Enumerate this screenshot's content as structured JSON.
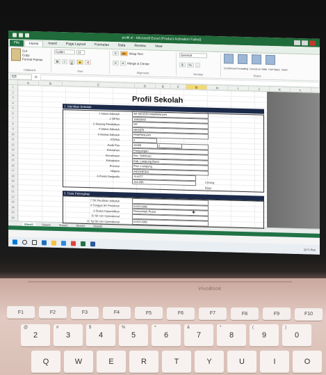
{
  "excel": {
    "window_title": "profil.xl - Microsoft Excel (Product Activation Failed)",
    "tabs": [
      "File",
      "Home",
      "Insert",
      "Page Layout",
      "Formulas",
      "Data",
      "Review",
      "View"
    ],
    "ribbon": {
      "clipboard": {
        "cut": "Cut",
        "copy": "Copy",
        "format_painter": "Format Painter",
        "paste": "Paste",
        "label": "Clipboard"
      },
      "font": {
        "name": "Calibri",
        "size": "11",
        "label": "Font"
      },
      "alignment": {
        "wrap_text": "Wrap Text",
        "merge_center": "Merge & Center",
        "label": "Alignment"
      },
      "number": {
        "format": "General",
        "label": "Number"
      },
      "styles": {
        "conditional": "Conditional Formatting",
        "format_as_table": "Format as Table",
        "cell_styles": "Cell Styles",
        "label": "Styles"
      },
      "insert": "Insert"
    },
    "namebox": "G3",
    "fx": "fx",
    "columns": [
      "A",
      "B",
      "C",
      "D",
      "E",
      "F",
      "G",
      "H",
      "I",
      "J",
      "K",
      "L"
    ],
    "selected_column": "G",
    "rows": [
      "1",
      "2",
      "3",
      "4",
      "5",
      "6",
      "7",
      "8",
      "9",
      "10",
      "11",
      "12",
      "13",
      "14",
      "15",
      "16",
      "17",
      "18",
      "19",
      "20",
      "21",
      "22",
      "23",
      "24",
      "25",
      "26"
    ],
    "sheet_title": "Profil Sekolah",
    "section1": {
      "header": "1. Identitas Sekolah",
      "fields": [
        {
          "label": "1 Nama Sekolah",
          "value": "SD NEGERI PAMPANGAN"
        },
        {
          "label": "2 NPSN",
          "value": "10803849"
        },
        {
          "label": "3 Jenjang Pendidikan",
          "value": "SD"
        },
        {
          "label": "4 Status Sekolah",
          "value": "NEGERI"
        },
        {
          "label": "5 Alamat Sekolah",
          "value": "PAMPANGAN"
        },
        {
          "label": "RT/RW",
          "value": "2"
        },
        {
          "label": "Kode Pos",
          "value": "34065"
        },
        {
          "label": "Kelurahan",
          "value": "Pampangan"
        },
        {
          "label": "Kecamatan",
          "value": "Kec. Sekincau"
        },
        {
          "label": "Kabupaten",
          "value": "Kab. Lampung Barat"
        },
        {
          "label": "Provinsi",
          "value": "Prov. Lampung"
        },
        {
          "label": "Negara",
          "value": "INDONESIA"
        },
        {
          "label": "6 Posisi Geografis",
          "value": "-5.0477"
        },
        {
          "label": "",
          "value": "104.295"
        }
      ],
      "rw_value": "2",
      "lintang": "Lintang",
      "bujur": "Bujur"
    },
    "section2": {
      "header": "2. Data Pelengkap",
      "fields": [
        {
          "label": "7 SK Pendirian Sekolah",
          "value": ""
        },
        {
          "label": "8 Tanggal SK Pendirian",
          "value": "01/01/1982"
        },
        {
          "label": "9 Status Kepemilikan",
          "value": "Pemerintah Pusat"
        },
        {
          "label": "10 SK Izin Operasional",
          "value": ""
        },
        {
          "label": "11 Tgl SK Izin Operasional",
          "value": "01/01/1982"
        }
      ]
    },
    "sheet_tabs": [
      "Sheet1",
      "Sheet2",
      "Sheet3",
      "Sheet4",
      "Sheet5"
    ],
    "active_sheet": "Sheet1"
  },
  "taskbar": {
    "time": "22°C Pen"
  },
  "laptop": {
    "brand": "VivoBook",
    "keys_fn": [
      "F1",
      "F2",
      "F3",
      "F4",
      "F5",
      "F6",
      "F7",
      "F8",
      "F9",
      "F10"
    ],
    "keys_num": [
      {
        "main": "2",
        "sub": "@"
      },
      {
        "main": "3",
        "sub": "#"
      },
      {
        "main": "4",
        "sub": "$"
      },
      {
        "main": "5",
        "sub": "%"
      },
      {
        "main": "6",
        "sub": "^"
      },
      {
        "main": "7",
        "sub": "&"
      },
      {
        "main": "8",
        "sub": "*"
      },
      {
        "main": "9",
        "sub": "("
      },
      {
        "main": "0",
        "sub": ")"
      }
    ],
    "keys_q": [
      "Q",
      "W",
      "E",
      "R",
      "T",
      "Y",
      "U",
      "I",
      "O"
    ]
  }
}
